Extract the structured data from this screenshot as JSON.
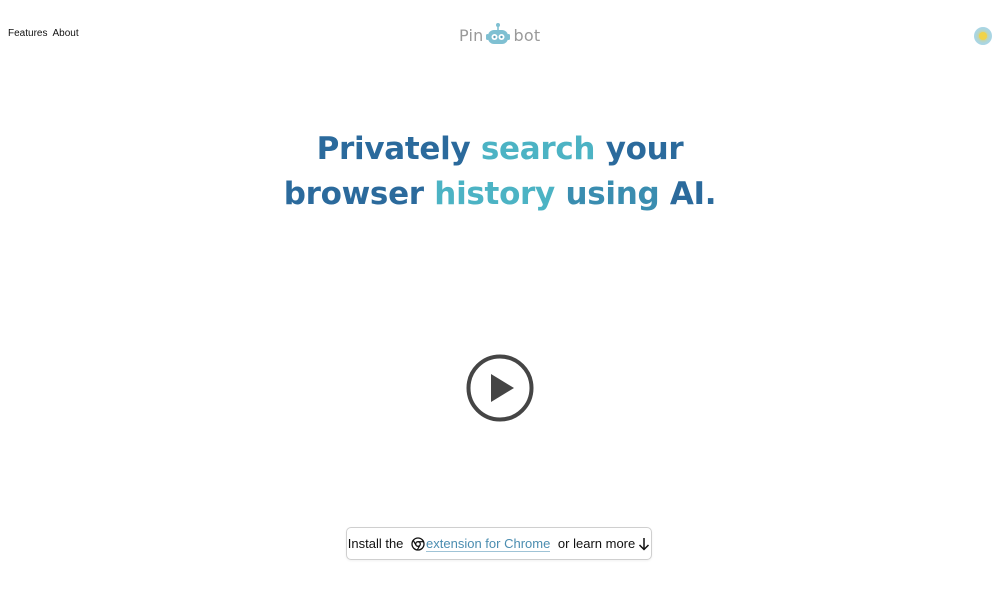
{
  "nav": {
    "features_label": "Features",
    "about_label": "About"
  },
  "logo": {
    "left_text": "Pin",
    "right_text": "bot",
    "icon": "robot-icon"
  },
  "theme_toggle": {
    "icon": "sun-icon"
  },
  "hero": {
    "line1": [
      {
        "text": "Privately ",
        "color": "#2b6a9c"
      },
      {
        "text": "search ",
        "color": "#4cb3c4"
      },
      {
        "text": "your",
        "color": "#2b6a9c"
      }
    ],
    "line2": [
      {
        "text": "browser ",
        "color": "#2b6a9c"
      },
      {
        "text": "history ",
        "color": "#4cb3c4"
      },
      {
        "text": "using ",
        "color": "#3a8db0"
      },
      {
        "text": "AI.",
        "color": "#2b6a9c"
      }
    ]
  },
  "video": {
    "play_icon": "play-icon"
  },
  "cta": {
    "prefix": "Install the ",
    "link_text": "extension for Chrome",
    "suffix": " or learn more",
    "icon_chrome": "chrome-icon",
    "icon_arrow": "arrow-down-icon"
  },
  "colors": {
    "primary_blue": "#2b6a9c",
    "accent_teal": "#4cb3c4",
    "link_blue": "#4b8db0",
    "logo_gray": "#9a9a9a",
    "toggle_bg": "#a9d6e6"
  }
}
